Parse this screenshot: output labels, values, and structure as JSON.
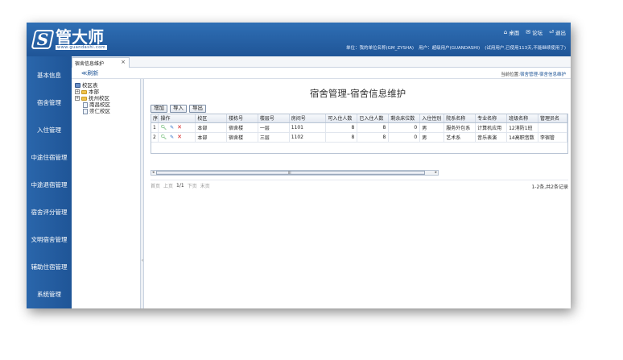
{
  "logo": {
    "mark": "S",
    "name": "管大师",
    "url": "www.guandashi.com"
  },
  "toplinks": [
    {
      "icon": "home-icon",
      "glyph": "⌂",
      "label": "桌面"
    },
    {
      "icon": "chat-icon",
      "glyph": "✉",
      "label": "论坛"
    },
    {
      "icon": "exit-icon",
      "glyph": "⏎",
      "label": "退出"
    }
  ],
  "userinfo": {
    "unit": "单位：我的单位名称(GM_ZYSHA)",
    "user": "用户：超级用户(GUANDASHI)",
    "trial": "(试用用户,已使用113天,不能继续使用了)"
  },
  "nav": [
    "基本信息",
    "宿舍管理",
    "入住管理",
    "中途住宿管理",
    "中途退宿管理",
    "宿舍评分管理",
    "文明宿舍管理",
    "辅助住宿管理",
    "系统管理"
  ],
  "tab": {
    "label": "宿舍信息维护",
    "close": "×"
  },
  "subbar": {
    "refresh": "≪刷新",
    "location_prefix": "当前位置:",
    "location_link": "宿舍管理-宿舍信息维护"
  },
  "tree": {
    "root": "校区表",
    "nodes": [
      {
        "label": "本部",
        "level": 1,
        "toggle": "+"
      },
      {
        "label": "抚州校区",
        "level": 1,
        "toggle": "+"
      },
      {
        "label": "南昌校区",
        "level": 2
      },
      {
        "label": "崇仁校区",
        "level": 2
      }
    ]
  },
  "page_title": "宿舍管理-宿舍信息维护",
  "toolbar": {
    "add": "增加",
    "import": "导入",
    "export": "导出"
  },
  "table": {
    "headers": [
      "序",
      "操作",
      "校区",
      "楼栋号",
      "楼层号",
      "房间号",
      "可入住人数",
      "已入住人数",
      "剩余床位数",
      "入住性别",
      "院系名称",
      "专业名称",
      "班级名称",
      "管理员名"
    ],
    "rows": [
      [
        "1",
        "",
        "本部",
        "宿舍楼",
        "一层",
        "1101",
        "8",
        "8",
        "0",
        "男",
        "服务外包系",
        "计算机应用",
        "12消防1班",
        ""
      ],
      [
        "2",
        "",
        "本部",
        "宿舍楼",
        "三层",
        "1102",
        "8",
        "8",
        "0",
        "男",
        "艺术系",
        "音乐表演",
        "14高职音数",
        "李宿管"
      ]
    ]
  },
  "scroll": {
    "left": "◂",
    "right": "▸",
    "grip": "III"
  },
  "pager": {
    "first": "首页",
    "prev": "上页",
    "current": "1/1",
    "next": "下页",
    "last": "末页",
    "total": "1-2条,共2条记录"
  },
  "colors": {
    "header_blue": "#1f5597",
    "nav_blue": "#2a66ab"
  }
}
